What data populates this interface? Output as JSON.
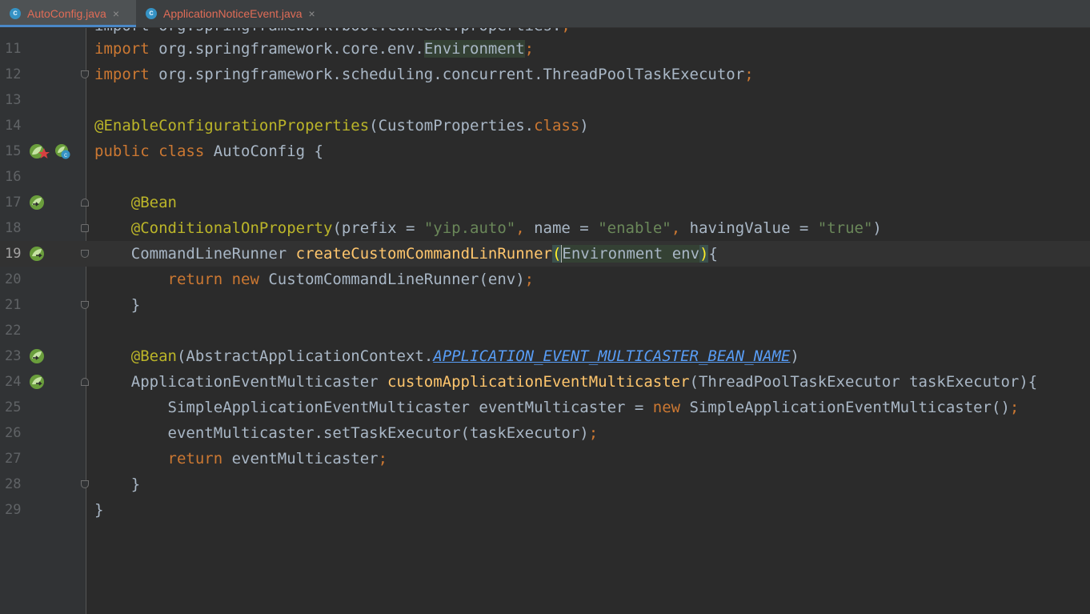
{
  "tabs": [
    {
      "label": "AutoConfig.java",
      "icon": "java-class-icon",
      "close": "×",
      "active": true
    },
    {
      "label": "ApplicationNoticeEvent.java",
      "icon": "java-class-icon",
      "close": "×",
      "active": false
    }
  ],
  "colors": {
    "background": "#2b2b2b",
    "keyword": "#cc7832",
    "annotation": "#bbb529",
    "string": "#6a8759",
    "method": "#ffc66d",
    "tab_text": "#e06c57"
  },
  "editor": {
    "current_line": 19,
    "lines": [
      {
        "num": "11",
        "t": [
          "import",
          " org.springframework.core.env.",
          "Environment",
          ";"
        ]
      },
      {
        "num": "12",
        "t": [
          "import",
          " org.springframework.scheduling.concurrent.ThreadPoolTaskExecutor",
          ";"
        ]
      },
      {
        "num": "13",
        "t": []
      },
      {
        "num": "14",
        "t": [
          "@EnableConfigurationProperties",
          "(CustomProperties.",
          "class",
          ")"
        ]
      },
      {
        "num": "15",
        "t": [
          "public class",
          " AutoConfig {"
        ]
      },
      {
        "num": "16",
        "t": []
      },
      {
        "num": "17",
        "t": [
          "    ",
          "@Bean"
        ]
      },
      {
        "num": "18",
        "t": [
          "    ",
          "@ConditionalOnProperty",
          "(prefix = ",
          "\"yip.auto\"",
          ", ",
          "name = ",
          "\"enable\"",
          ", ",
          "havingValue = ",
          "\"true\"",
          ")"
        ]
      },
      {
        "num": "19",
        "t": [
          "    CommandLineRunner ",
          "createCustomCommandLinRunner",
          "(",
          "Environment",
          " env",
          ")",
          "{"
        ]
      },
      {
        "num": "20",
        "t": [
          "        ",
          "return new",
          " CustomCommandLineRunner(env)",
          ";"
        ]
      },
      {
        "num": "21",
        "t": [
          "    }"
        ]
      },
      {
        "num": "22",
        "t": []
      },
      {
        "num": "23",
        "t": [
          "    ",
          "@Bean",
          "(AbstractApplicationContext.",
          "APPLICATION_EVENT_MULTICASTER_BEAN_NAME",
          ")"
        ]
      },
      {
        "num": "24",
        "t": [
          "    ApplicationEventMulticaster ",
          "customApplicationEventMulticaster",
          "(ThreadPoolTaskExecutor taskExecutor){"
        ]
      },
      {
        "num": "25",
        "t": [
          "        SimpleApplicationEventMulticaster eventMulticaster = ",
          "new",
          " SimpleApplicationEventMulticaster()",
          ";"
        ]
      },
      {
        "num": "26",
        "t": [
          "        eventMulticaster.setTaskExecutor(taskExecutor)",
          ";"
        ]
      },
      {
        "num": "27",
        "t": [
          "        ",
          "return",
          " eventMulticaster",
          ";"
        ]
      },
      {
        "num": "28",
        "t": [
          "    }"
        ]
      },
      {
        "num": "29",
        "t": [
          "}"
        ]
      }
    ]
  },
  "gutter_icons": [
    {
      "line": "15",
      "names": [
        "spring-bean-icon",
        "bookmark-star-icon",
        "spring-config-icon"
      ]
    },
    {
      "line": "17",
      "names": [
        "spring-bean-navigate-icon"
      ]
    },
    {
      "line": "19",
      "names": [
        "spring-bean-navigate-icon"
      ]
    },
    {
      "line": "23",
      "names": [
        "spring-bean-navigate-icon"
      ]
    },
    {
      "line": "24",
      "names": [
        "spring-bean-navigate-icon"
      ]
    }
  ]
}
